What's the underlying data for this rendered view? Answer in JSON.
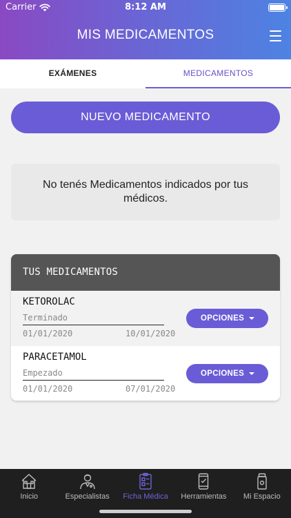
{
  "status_bar": {
    "carrier": "Carrier",
    "time": "8:12 AM"
  },
  "header": {
    "title": "MIS MEDICAMENTOS"
  },
  "tabs": [
    {
      "label": "EXÁMENES",
      "active": false
    },
    {
      "label": "MEDICAMENTOS",
      "active": true
    }
  ],
  "new_button": {
    "label": "NUEVO MEDICAMENTO"
  },
  "empty_message": "No tenés Medicamentos indicados por tus médicos.",
  "medications": {
    "header": "TUS MEDICAMENTOS",
    "items": [
      {
        "name": "KETOROLAC",
        "status": "Terminado",
        "start_date": "01/01/2020",
        "end_date": "10/01/2020",
        "options_label": "OPCIONES"
      },
      {
        "name": "PARACETAMOL",
        "status": "Empezado",
        "start_date": "01/01/2020",
        "end_date": "07/01/2020",
        "options_label": "OPCIONES"
      }
    ]
  },
  "bottom_nav": [
    {
      "label": "Inicio",
      "icon": "home-icon",
      "active": false
    },
    {
      "label": "Especialistas",
      "icon": "doctor-icon",
      "active": false
    },
    {
      "label": "Ficha Médica",
      "icon": "medical-record-icon",
      "active": true
    },
    {
      "label": "Herramientas",
      "icon": "phone-tools-icon",
      "active": false
    },
    {
      "label": "Mi Espacio",
      "icon": "medicine-bottle-icon",
      "active": false
    }
  ],
  "colors": {
    "header_gradient": [
      "#8a49c3",
      "#6966d5",
      "#4d83e3"
    ],
    "accent": "#6a5cd6",
    "card_header": "#555555",
    "nav_background": "#1f1f1f",
    "nav_active": "#6f64d8"
  }
}
